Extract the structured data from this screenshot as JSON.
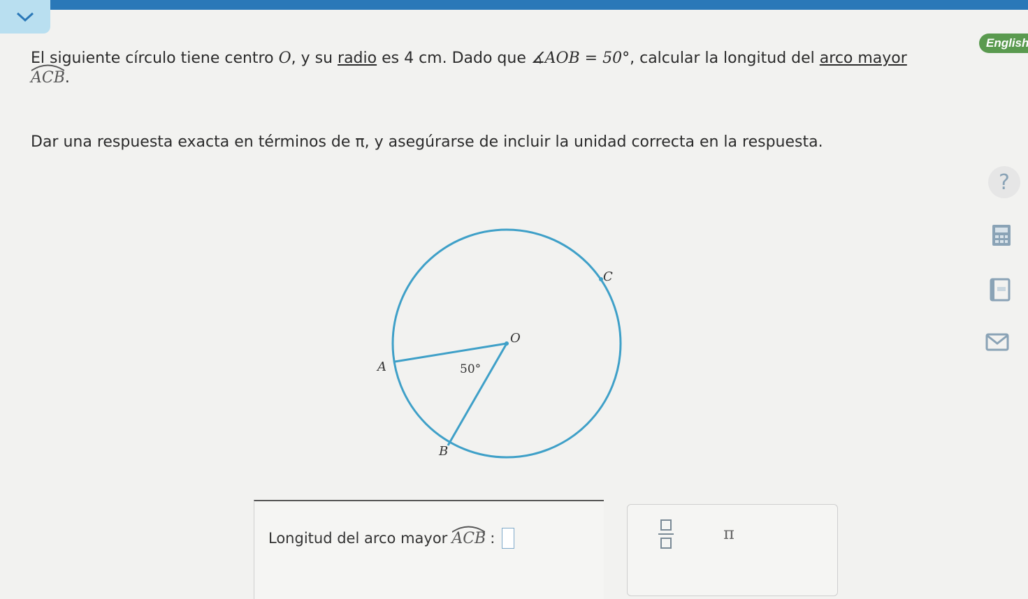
{
  "problem": {
    "p1": "El siguiente círculo tiene centro ",
    "center": "O",
    "p2": ", y su ",
    "radio_link": "radio",
    "p3": " es 4 cm. Dado que ",
    "angle_expr": "∡AOB = 50°",
    "p4": ", calcular la longitud del ",
    "arc_link": "arco mayor",
    "arc_name": "ACB",
    "p5": "."
  },
  "instructions": "Dar una respuesta exacta en términos de π, y asegúrarse de incluir la unidad correcta en la respuesta.",
  "language_button": "English",
  "help_symbol": "?",
  "diagram": {
    "label_o": "O",
    "label_a": "A",
    "label_b": "B",
    "label_c": "C",
    "angle_label": "50°",
    "circle_color": "#3fa0c8",
    "line_color": "#3fa0c8"
  },
  "answer": {
    "label": "Longitud del arco mayor",
    "arc_name": "ACB",
    "colon": ":"
  },
  "keypad": {
    "pi_label": "π"
  },
  "icons": [
    "chevron-down-icon",
    "help-icon",
    "calculator-icon",
    "dictionary-icon",
    "mail-icon",
    "fraction-icon"
  ]
}
